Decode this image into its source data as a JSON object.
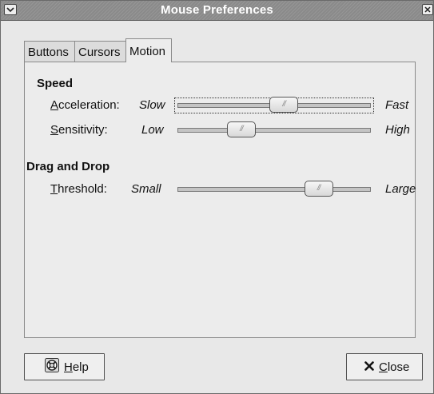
{
  "window": {
    "title": "Mouse Preferences"
  },
  "tabs": [
    {
      "label": "Buttons",
      "active": false
    },
    {
      "label": "Cursors",
      "active": false
    },
    {
      "label": "Motion",
      "active": true
    }
  ],
  "speed": {
    "title": "Speed",
    "acceleration": {
      "mnemonic": "A",
      "rest": "cceleration:",
      "low": "Slow",
      "high": "Fast",
      "level": 0.55
    },
    "sensitivity": {
      "mnemonic": "S",
      "rest": "ensitivity:",
      "low": "Low",
      "high": "High",
      "level": 0.33
    }
  },
  "drag_drop": {
    "title": "Drag and Drop",
    "threshold": {
      "mnemonic": "T",
      "rest": "hreshold:",
      "low": "Small",
      "high": "Large",
      "level": 0.73
    }
  },
  "buttons": {
    "help": {
      "mnemonic": "H",
      "rest": "elp"
    },
    "close": {
      "mnemonic": "C",
      "rest": "lose"
    }
  },
  "icons": {
    "help": "help-lifebuoy-icon",
    "close": "x-close-icon",
    "menu": "window-menu-icon",
    "window_close": "window-close-icon"
  }
}
